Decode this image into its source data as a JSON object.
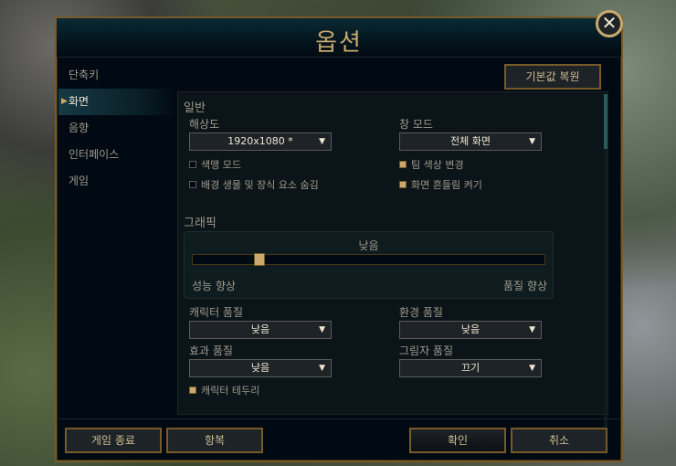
{
  "window": {
    "title": "옵션",
    "close_label": "✕"
  },
  "sidebar": {
    "items": [
      {
        "label": "단축키",
        "active": false
      },
      {
        "label": "화면",
        "active": true
      },
      {
        "label": "음향",
        "active": false
      },
      {
        "label": "인터페이스",
        "active": false
      },
      {
        "label": "게임",
        "active": false
      }
    ]
  },
  "toolbar": {
    "restore_defaults": "기본값 복원"
  },
  "general": {
    "title": "일반",
    "resolution_label": "해상도",
    "resolution_value": "1920x1080 *",
    "window_mode_label": "창 모드",
    "window_mode_value": "전체 화면",
    "colorblind_mode": {
      "label": "색맹 모드",
      "checked": false
    },
    "hide_eyecandy": {
      "label": "배경 생물 및 장식 요소 숨김",
      "checked": false
    },
    "team_color_change": {
      "label": "팀 색상 변경",
      "checked": true
    },
    "screen_shake": {
      "label": "화면 흔들림 켜기",
      "checked": true
    }
  },
  "graphics": {
    "title": "그래픽",
    "slider_value_label": "낮음",
    "slider_level": 0.18,
    "left_label": "성능 향상",
    "right_label": "품질 향상",
    "character_quality_label": "캐릭터 품질",
    "character_quality_value": "낮음",
    "environment_quality_label": "환경 품질",
    "environment_quality_value": "낮음",
    "effects_quality_label": "효과 품질",
    "effects_quality_value": "낮음",
    "shadow_quality_label": "그림자 품질",
    "shadow_quality_value": "끄기",
    "character_inking": {
      "label": "캐릭터 테두리",
      "checked": true
    }
  },
  "footer": {
    "exit_game": "게임 종료",
    "surrender": "항복",
    "ok": "확인",
    "cancel": "취소"
  },
  "colors": {
    "gold": "#c8aa6e",
    "frame": "#785a28",
    "bg": "#010a13"
  }
}
